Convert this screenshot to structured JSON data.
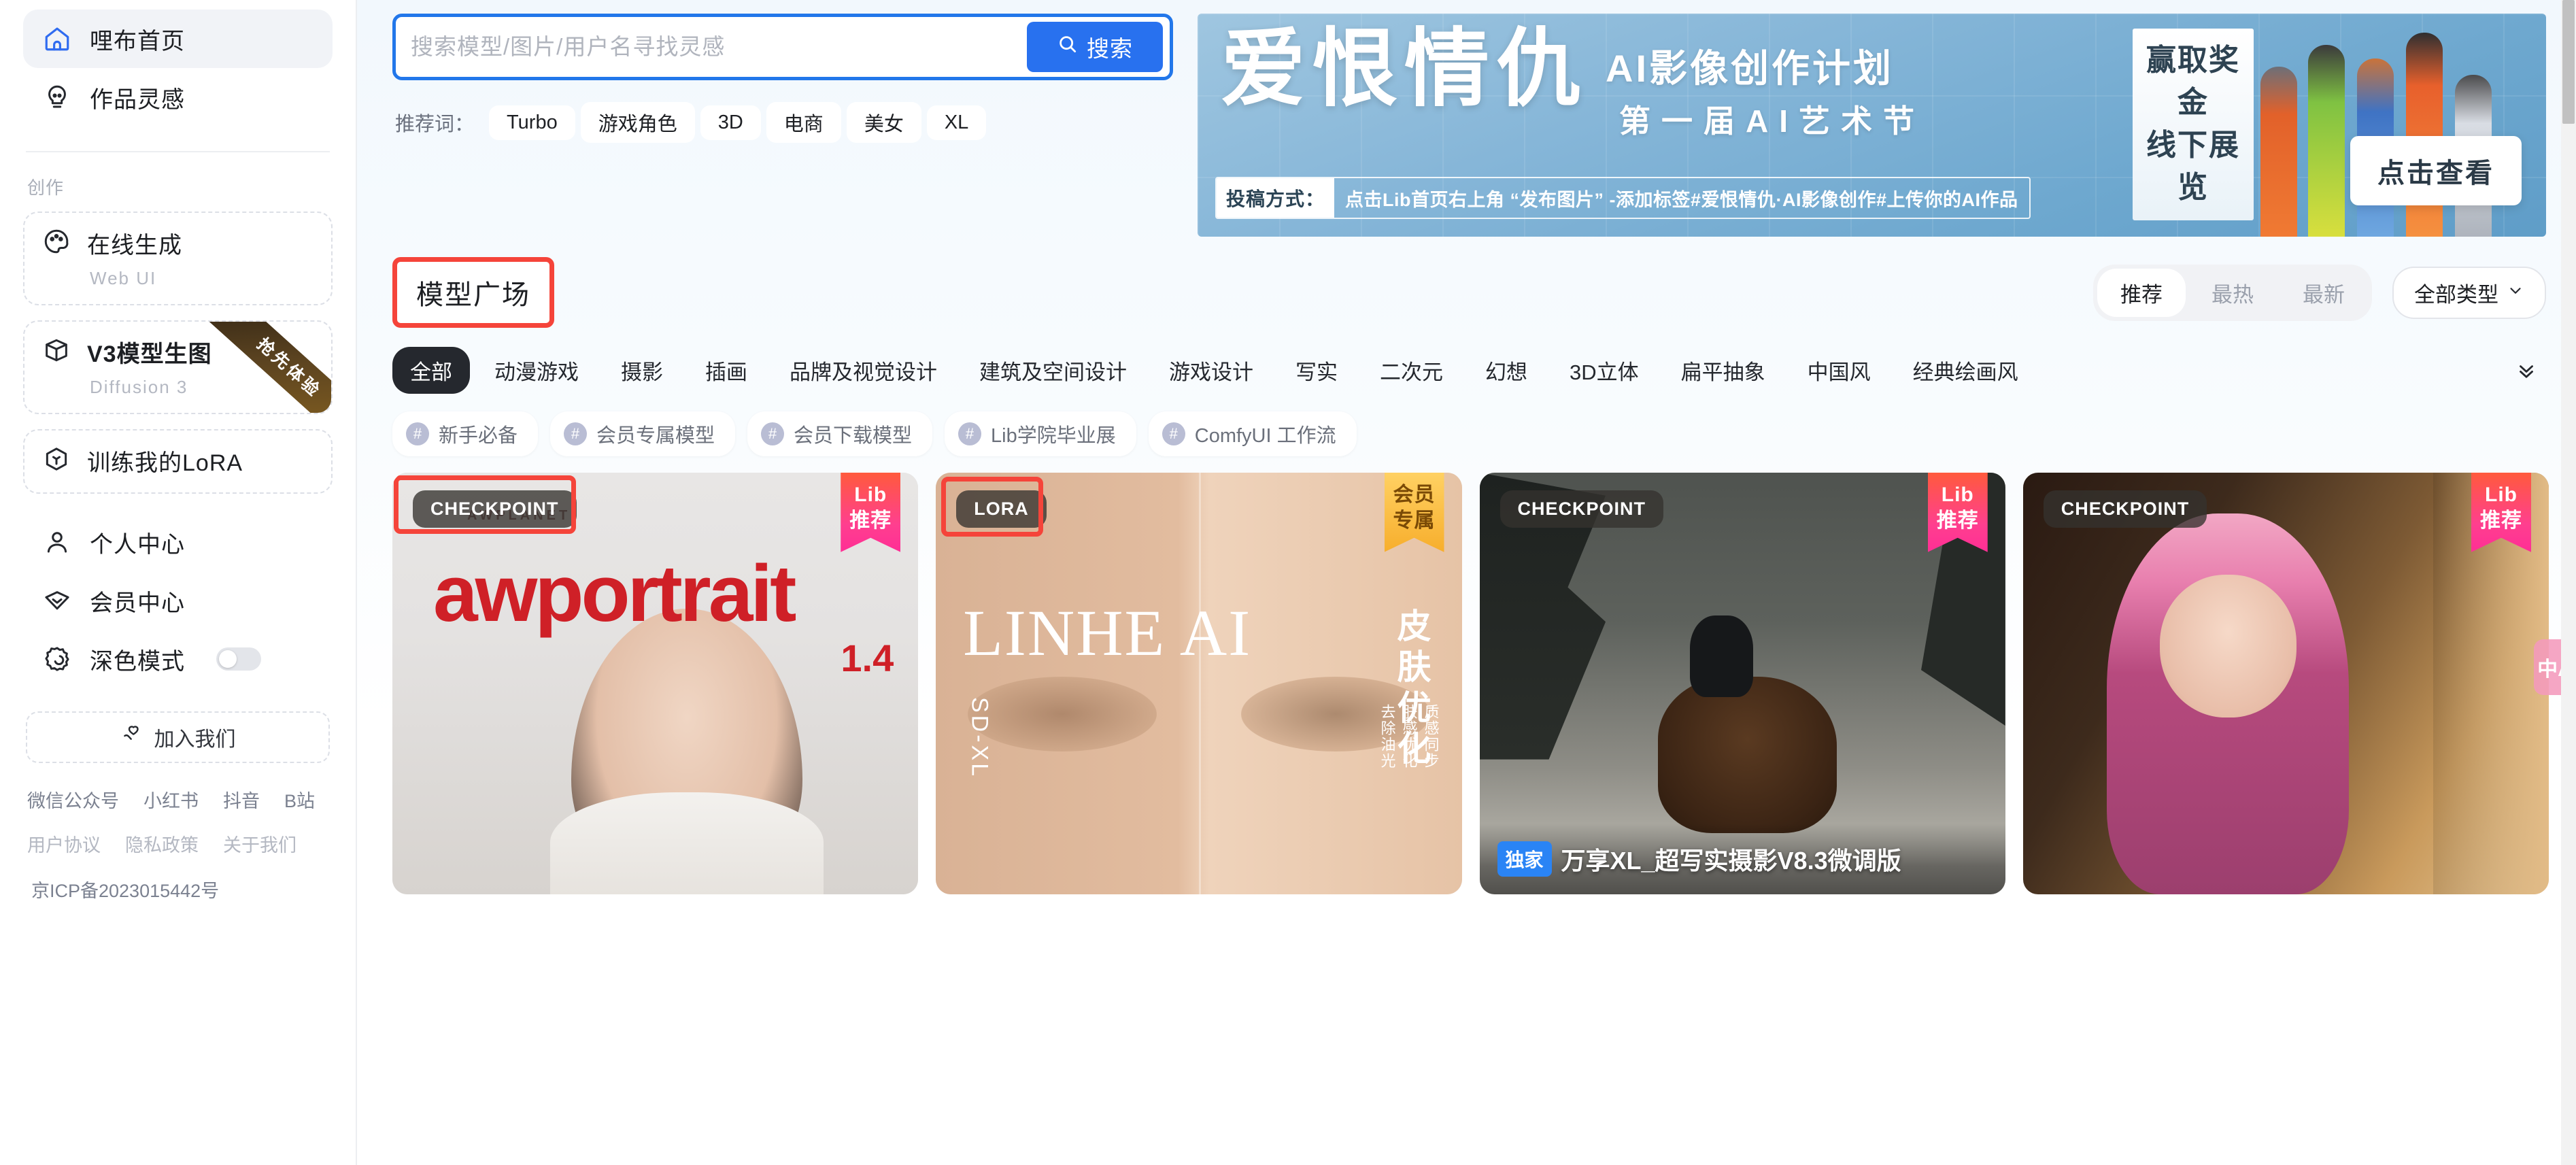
{
  "sidebar": {
    "primary": [
      {
        "label": "哩布首页",
        "icon": "home-icon",
        "active": true
      },
      {
        "label": "作品灵感",
        "icon": "inspiration-icon",
        "active": false
      }
    ],
    "section_label": "创作",
    "create_cards": [
      {
        "title": "在线生成",
        "subtitle": "Web UI",
        "icon": "palette-icon",
        "ribbon": "",
        "bold": false
      },
      {
        "title": "V3模型生图",
        "subtitle": "Diffusion 3",
        "icon": "cube-icon",
        "ribbon": "抢先体验",
        "bold": true
      },
      {
        "title": "训练我的LoRA",
        "subtitle": "",
        "icon": "lora-icon",
        "ribbon": "",
        "bold": false
      }
    ],
    "secondary": [
      {
        "label": "个人中心",
        "icon": "user-icon"
      },
      {
        "label": "会员中心",
        "icon": "vip-icon"
      }
    ],
    "dark_mode": {
      "label": "深色模式",
      "icon": "moon-icon",
      "enabled": false
    },
    "join_button": {
      "label": "加入我们",
      "icon": "heart-hand-icon"
    },
    "social_links": [
      "微信公众号",
      "小红书",
      "抖音",
      "B站"
    ],
    "legal_links": [
      "用户协议",
      "隐私政策",
      "关于我们"
    ],
    "icp": "京ICP备2023015442号"
  },
  "search": {
    "value": "",
    "placeholder": "搜索模型/图片/用户名寻找灵感",
    "button_label": "搜索",
    "button_icon": "search-icon",
    "rec_label": "推荐词：",
    "rec_tags": [
      "Turbo",
      "游戏角色",
      "3D",
      "电商",
      "美女",
      "XL"
    ]
  },
  "banner": {
    "title": "爱恨情仇",
    "subtitle1": "AI影像创作计划",
    "subtitle2": "第一届AI艺术节",
    "prize_line1": "赢取奖金",
    "prize_line2": "线下展览",
    "submit_label": "投稿方式：",
    "submit_detail": "点击Lib首页右上角 “发布图片” -添加标签#爱恨情仇·AI影像创作#上传你的AI作品",
    "cta": "点击查看"
  },
  "section": {
    "title": "模型广场",
    "sort_tabs": [
      {
        "label": "推荐",
        "active": true
      },
      {
        "label": "最热",
        "active": false
      },
      {
        "label": "最新",
        "active": false
      }
    ],
    "type_filter": {
      "label": "全部类型",
      "icon": "chevron-down-icon"
    },
    "categories": [
      {
        "label": "全部",
        "active": true
      },
      {
        "label": "动漫游戏",
        "active": false
      },
      {
        "label": "摄影",
        "active": false
      },
      {
        "label": "插画",
        "active": false
      },
      {
        "label": "品牌及视觉设计",
        "active": false
      },
      {
        "label": "建筑及空间设计",
        "active": false
      },
      {
        "label": "游戏设计",
        "active": false
      },
      {
        "label": "写实",
        "active": false
      },
      {
        "label": "二次元",
        "active": false
      },
      {
        "label": "幻想",
        "active": false
      },
      {
        "label": "3D立体",
        "active": false
      },
      {
        "label": "扁平抽象",
        "active": false
      },
      {
        "label": "中国风",
        "active": false
      },
      {
        "label": "经典绘画风",
        "active": false
      }
    ],
    "expand_icon": "double-chevron-down-icon",
    "tags": [
      "新手必备",
      "会员专属模型",
      "会员下载模型",
      "Lib学院毕业展",
      "ComfyUI 工作流"
    ]
  },
  "cards": [
    {
      "type_badge": "CHECKPOINT",
      "ribbon_line1": "Lib",
      "ribbon_line2": "推荐",
      "ribbon_style": "pink",
      "cover_brand": "AWPLANET",
      "cover_title": "awportrait",
      "cover_version": "1.4",
      "title": "",
      "exclusive": "",
      "highlighted": true
    },
    {
      "type_badge": "LORA",
      "ribbon_line1": "会员",
      "ribbon_line2": "专属",
      "ribbon_style": "gold",
      "cover_brand": "",
      "cover_title": "LINHE AI",
      "cover_sub": "皮肤优化",
      "cover_side": "SD-XL",
      "cover_note1": "质感同步",
      "cover_note2": "肤感优化",
      "cover_note3": "去除油光",
      "title": "",
      "exclusive": "",
      "highlighted": true
    },
    {
      "type_badge": "CHECKPOINT",
      "ribbon_line1": "Lib",
      "ribbon_line2": "推荐",
      "ribbon_style": "pink",
      "title": "万享XL_超写实摄影V8.3微调版",
      "exclusive": "独家",
      "highlighted": false
    },
    {
      "type_badge": "CHECKPOINT",
      "ribbon_line1": "Lib",
      "ribbon_line2": "推荐",
      "ribbon_style": "pink",
      "title": "",
      "exclusive": "",
      "highlighted": false
    }
  ],
  "floating": {
    "lang_button": "中A"
  },
  "colors": {
    "accent_blue": "#2871ef",
    "highlight_red": "#f5443a",
    "ribbon_pink": "#ff3f8f",
    "ribbon_gold": "#f7ae2c",
    "dark_badge": "#34322e"
  }
}
